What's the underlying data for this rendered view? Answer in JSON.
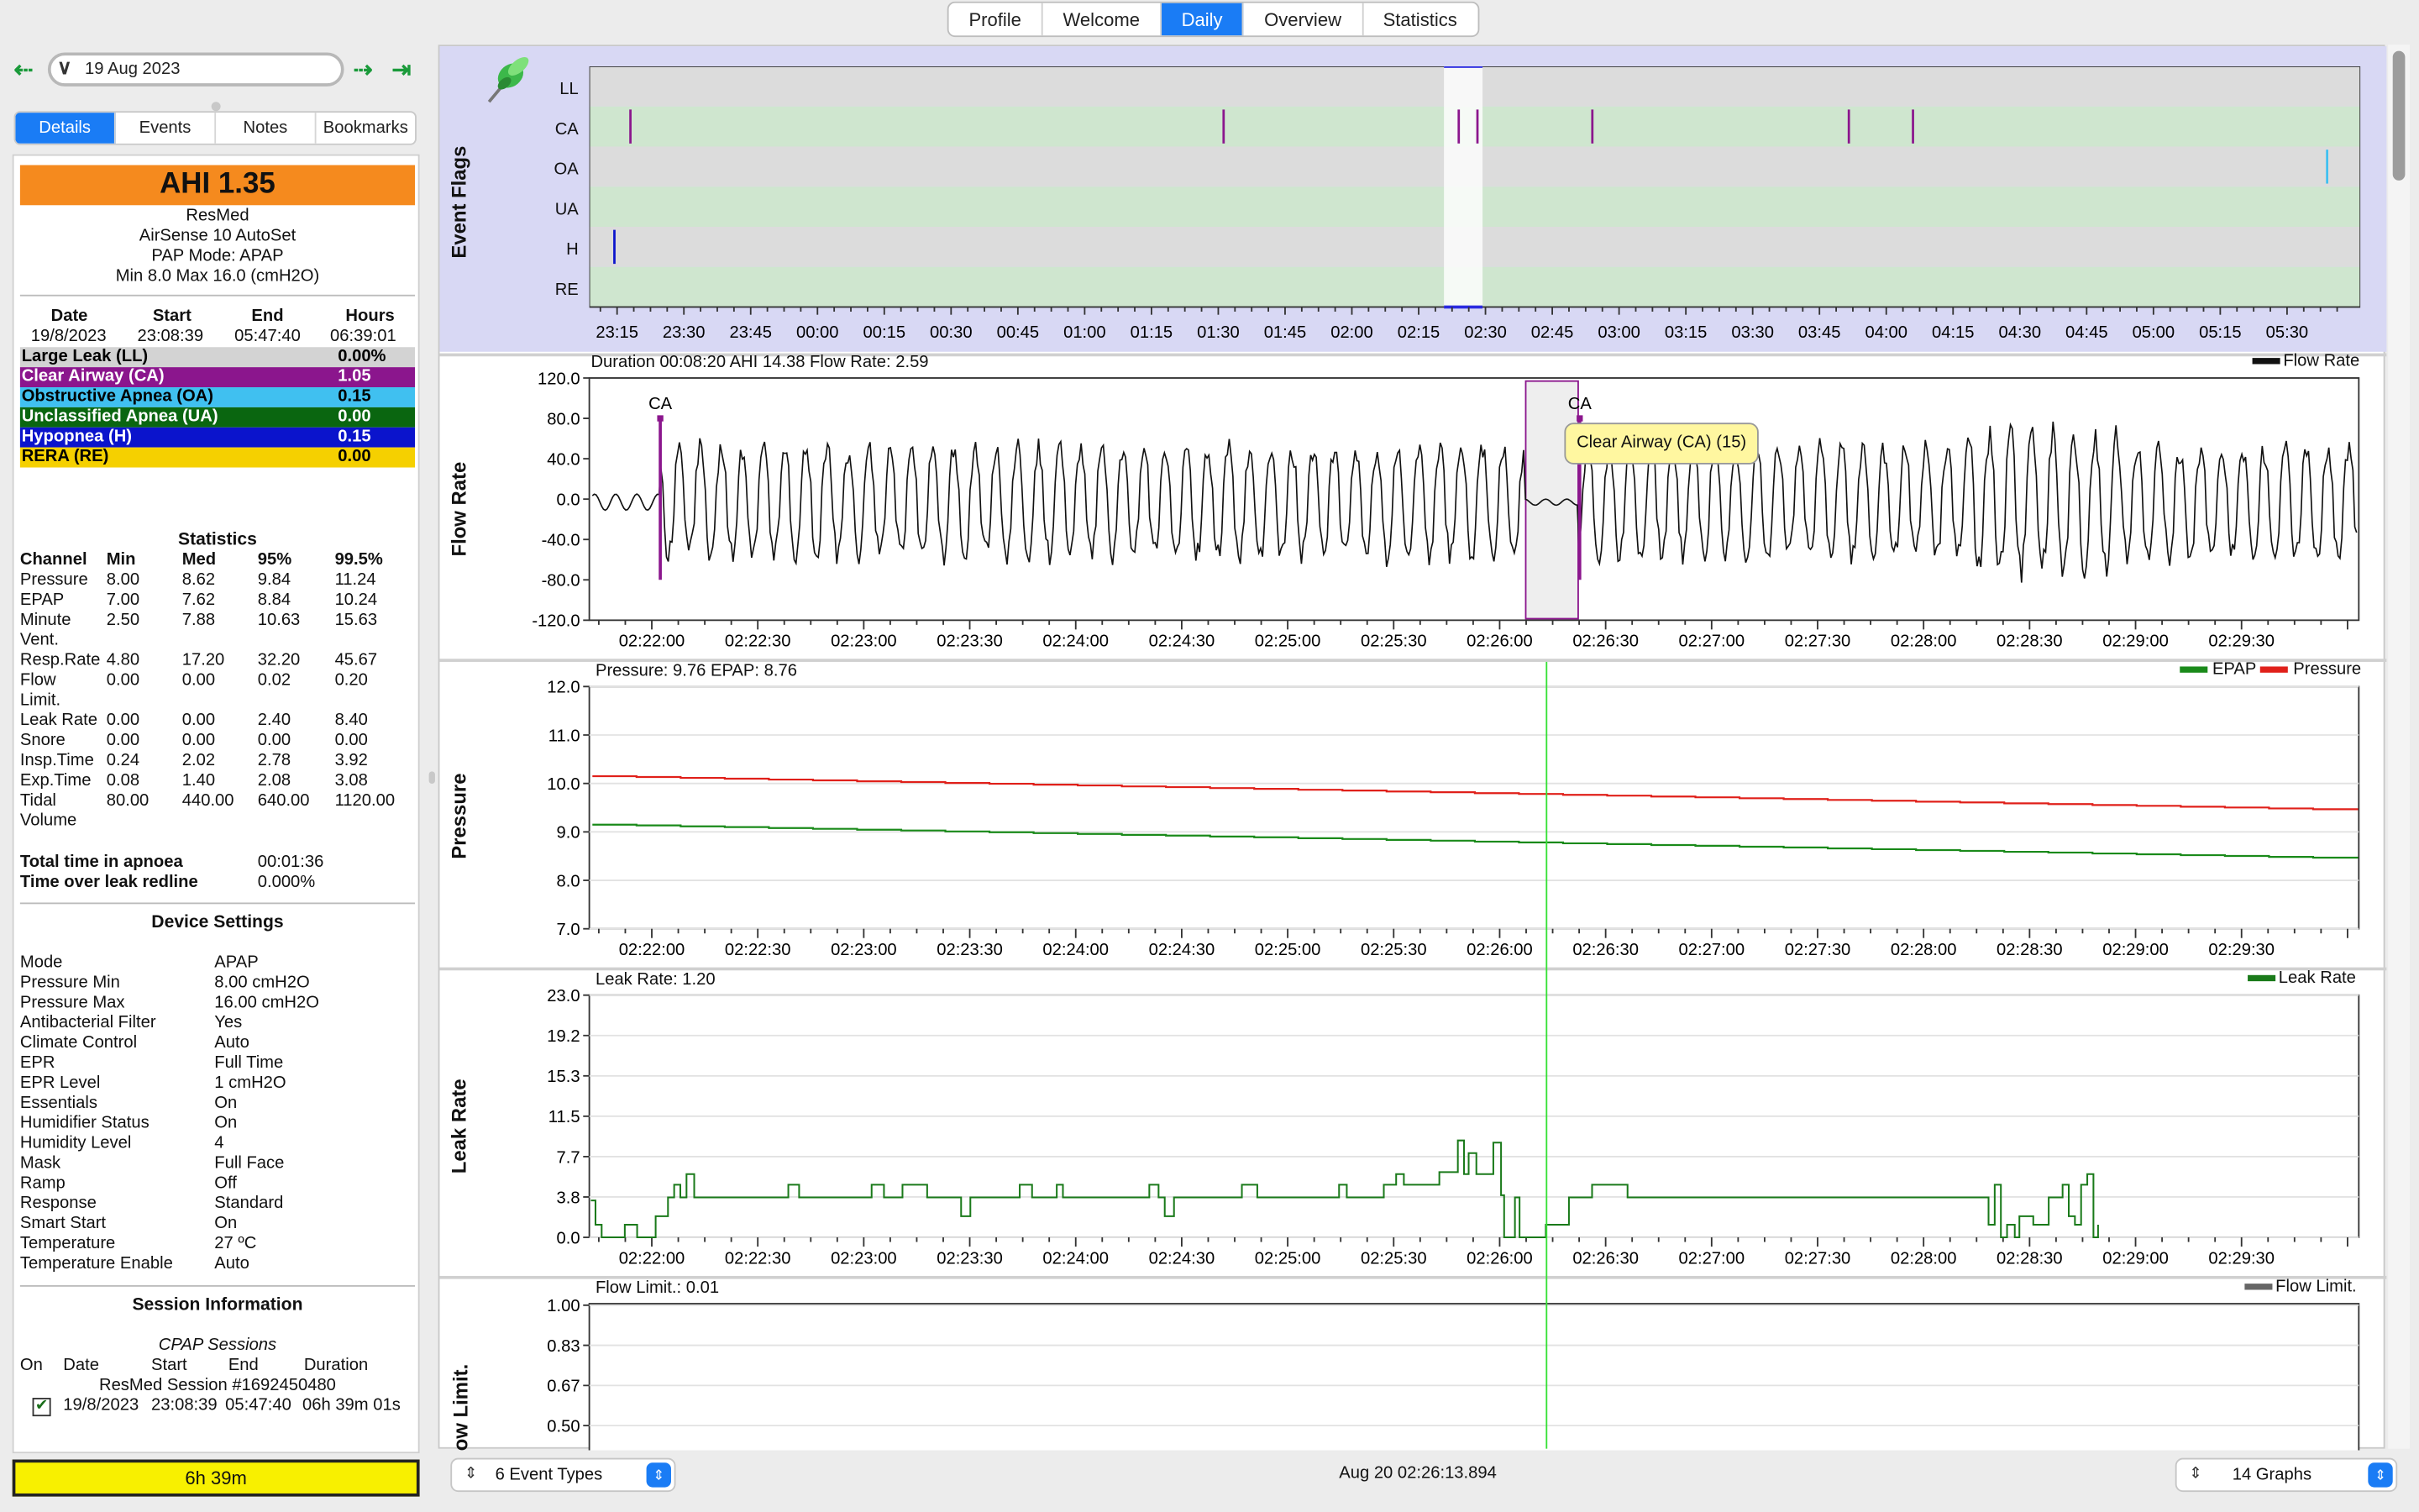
{
  "top_tabs": [
    "Profile",
    "Welcome",
    "Daily",
    "Overview",
    "Statistics"
  ],
  "active_top_tab": "Daily",
  "nav": {
    "date": "19 Aug 2023"
  },
  "sub_tabs": [
    "Details",
    "Events",
    "Notes",
    "Bookmarks"
  ],
  "active_sub_tab": "Details",
  "summary": {
    "ahi": "AHI 1.35",
    "brand": "ResMed",
    "model": "AirSense 10 AutoSet",
    "pap_mode": "PAP Mode: APAP",
    "pressure_range": "Min 8.0 Max 16.0 (cmH2O)",
    "headers": [
      "Date",
      "Start",
      "End",
      "Hours"
    ],
    "values": [
      "19/8/2023",
      "23:08:39",
      "05:47:40",
      "06:39:01"
    ]
  },
  "events": [
    {
      "label": "Large Leak (LL)",
      "value": "0.00%",
      "bg": "#d3d3d3",
      "fg": "#000000"
    },
    {
      "label": "Clear Airway (CA)",
      "value": "1.05",
      "bg": "#8b168d",
      "fg": "#ffffff"
    },
    {
      "label": "Obstructive Apnea (OA)",
      "value": "0.15",
      "bg": "#40c0f0",
      "fg": "#000000"
    },
    {
      "label": "Unclassified Apnea (UA)",
      "value": "0.00",
      "bg": "#0a6610",
      "fg": "#ffffff"
    },
    {
      "label": "Hypopnea (H)",
      "value": "0.15",
      "bg": "#0b14cc",
      "fg": "#ffffff"
    },
    {
      "label": "RERA (RE)",
      "value": "0.00",
      "bg": "#f5d000",
      "fg": "#000000"
    }
  ],
  "statistics": {
    "title": "Statistics",
    "headers": [
      "Channel",
      "Min",
      "Med",
      "95%",
      "99.5%"
    ],
    "rows": [
      {
        "name": "Pressure",
        "cont": "",
        "v": [
          "8.00",
          "8.62",
          "9.84",
          "11.24"
        ]
      },
      {
        "name": "EPAP",
        "cont": "",
        "v": [
          "7.00",
          "7.62",
          "8.84",
          "10.24"
        ]
      },
      {
        "name": "Minute",
        "cont": "Vent.",
        "v": [
          "2.50",
          "7.88",
          "10.63",
          "15.63"
        ]
      },
      {
        "name": "Resp.Rate",
        "cont": "",
        "v": [
          "4.80",
          "17.20",
          "32.20",
          "45.67"
        ]
      },
      {
        "name": "Flow",
        "cont": "Limit.",
        "v": [
          "0.00",
          "0.00",
          "0.02",
          "0.20"
        ]
      },
      {
        "name": "Leak Rate",
        "cont": "",
        "v": [
          "0.00",
          "0.00",
          "2.40",
          "8.40"
        ]
      },
      {
        "name": "Snore",
        "cont": "",
        "v": [
          "0.00",
          "0.00",
          "0.00",
          "0.00"
        ]
      },
      {
        "name": "Insp.Time",
        "cont": "",
        "v": [
          "0.24",
          "2.02",
          "2.78",
          "3.92"
        ]
      },
      {
        "name": "Exp.Time",
        "cont": "",
        "v": [
          "0.08",
          "1.40",
          "2.08",
          "3.08"
        ]
      },
      {
        "name": "Tidal",
        "cont": "Volume",
        "v": [
          "80.00",
          "440.00",
          "640.00",
          "1120.00"
        ]
      }
    ],
    "total_apnoea_label": "Total time in apnoea",
    "total_apnoea": "00:01:36",
    "over_leak_label": "Time over leak redline",
    "over_leak": "0.000%"
  },
  "device_settings": {
    "title": "Device Settings",
    "items": [
      [
        "Mode",
        "APAP"
      ],
      [
        "Pressure Min",
        "8.00 cmH2O"
      ],
      [
        "Pressure Max",
        "16.00 cmH2O"
      ],
      [
        "Antibacterial Filter",
        "Yes"
      ],
      [
        "Climate Control",
        "Auto"
      ],
      [
        "EPR",
        "Full Time"
      ],
      [
        "EPR Level",
        "1 cmH2O"
      ],
      [
        "Essentials",
        "On"
      ],
      [
        "Humidifier Status",
        "On"
      ],
      [
        "Humidity Level",
        "4"
      ],
      [
        "Mask",
        "Full Face"
      ],
      [
        "Ramp",
        "Off"
      ],
      [
        "Response",
        "Standard"
      ],
      [
        "Smart Start",
        "On"
      ],
      [
        "Temperature",
        "27 ºC"
      ],
      [
        "Temperature Enable",
        "Auto"
      ]
    ]
  },
  "session_info": {
    "title": "Session Information",
    "subtitle": "CPAP Sessions",
    "headers": [
      "On",
      "Date",
      "Start",
      "End",
      "Duration"
    ],
    "session_name": "ResMed Session #1692450480",
    "date": "19/8/2023",
    "start": "23:08:39",
    "end": "05:47:40",
    "duration": "06h 39m 01s",
    "checked": true
  },
  "usage_bar": "6h 39m",
  "event_flags": {
    "ylabel": "Event Flags",
    "rows": [
      "LL",
      "CA",
      "OA",
      "UA",
      "H",
      "RE"
    ],
    "time_ticks": [
      "23:15",
      "23:30",
      "23:45",
      "00:00",
      "00:15",
      "00:30",
      "00:45",
      "01:00",
      "01:15",
      "01:30",
      "01:45",
      "02:00",
      "02:15",
      "02:30",
      "02:45",
      "03:00",
      "03:15",
      "03:30",
      "03:45",
      "04:00",
      "04:15",
      "04:30",
      "04:45",
      "05:00",
      "05:15",
      "05:30"
    ],
    "ca_marks_hours": [
      -0.7,
      1.52,
      2.4,
      2.47,
      2.9,
      3.86,
      4.1
    ],
    "oa_marks_hours": [
      5.65
    ],
    "h_marks_hours": [
      -0.76
    ]
  },
  "time_ticks_zoom": [
    "02:22:00",
    "02:22:30",
    "02:23:00",
    "02:23:30",
    "02:24:00",
    "02:24:30",
    "02:25:00",
    "02:25:30",
    "02:26:00",
    "02:26:30",
    "02:27:00",
    "02:27:30",
    "02:28:00",
    "02:28:30",
    "02:29:00",
    "02:29:30"
  ],
  "flow_rate": {
    "ylabel": "Flow Rate",
    "info": "Duration 00:08:20 AHI 14.38 Flow Rate: 2.59",
    "legend": "Flow Rate",
    "yticks": [
      "120.0",
      "80.0",
      "40.0",
      "0.0",
      "-40.0",
      "-80.0",
      "-120.0"
    ],
    "ylim": [
      -120,
      120
    ],
    "ca_label_1": "CA",
    "ca_label_2": "CA",
    "tooltip": "Clear Airway (CA) (15)"
  },
  "pressure": {
    "ylabel": "Pressure",
    "info": "Pressure: 9.76 EPAP: 8.76",
    "legend": [
      "EPAP",
      "Pressure"
    ],
    "yticks": [
      "12.0",
      "11.0",
      "10.0",
      "9.0",
      "8.0",
      "7.0"
    ],
    "ylim": [
      7,
      12
    ],
    "pressure_start": 10.15,
    "pressure_end": 9.45,
    "epap_start": 9.15,
    "epap_end": 8.45
  },
  "leak_rate": {
    "ylabel": "Leak Rate",
    "info": "Leak Rate: 1.20",
    "legend": "Leak Rate",
    "yticks": [
      "23.0",
      "19.2",
      "15.3",
      "11.5",
      "7.7",
      "3.8",
      "0.0"
    ],
    "ylim": [
      0,
      23
    ]
  },
  "flow_limit": {
    "ylabel": "Flow Limit.",
    "info": "Flow Limit.: 0.01",
    "legend": "Flow Limit.",
    "yticks": [
      "1.00",
      "0.83",
      "0.67",
      "0.50"
    ],
    "ylim": [
      0,
      1
    ]
  },
  "bottom": {
    "event_types": "6 Event Types",
    "timestamp": "Aug 20 02:26:13.894",
    "graphs": "14 Graphs"
  },
  "colors": {
    "accent": "#1a7cf5",
    "ca": "#8b168d",
    "oa": "#40c0f0",
    "h": "#0b14cc",
    "pressure": "#e0201a",
    "epap": "#1a8a1a",
    "leak": "#1a7a1a",
    "cursor": "#36e036"
  }
}
